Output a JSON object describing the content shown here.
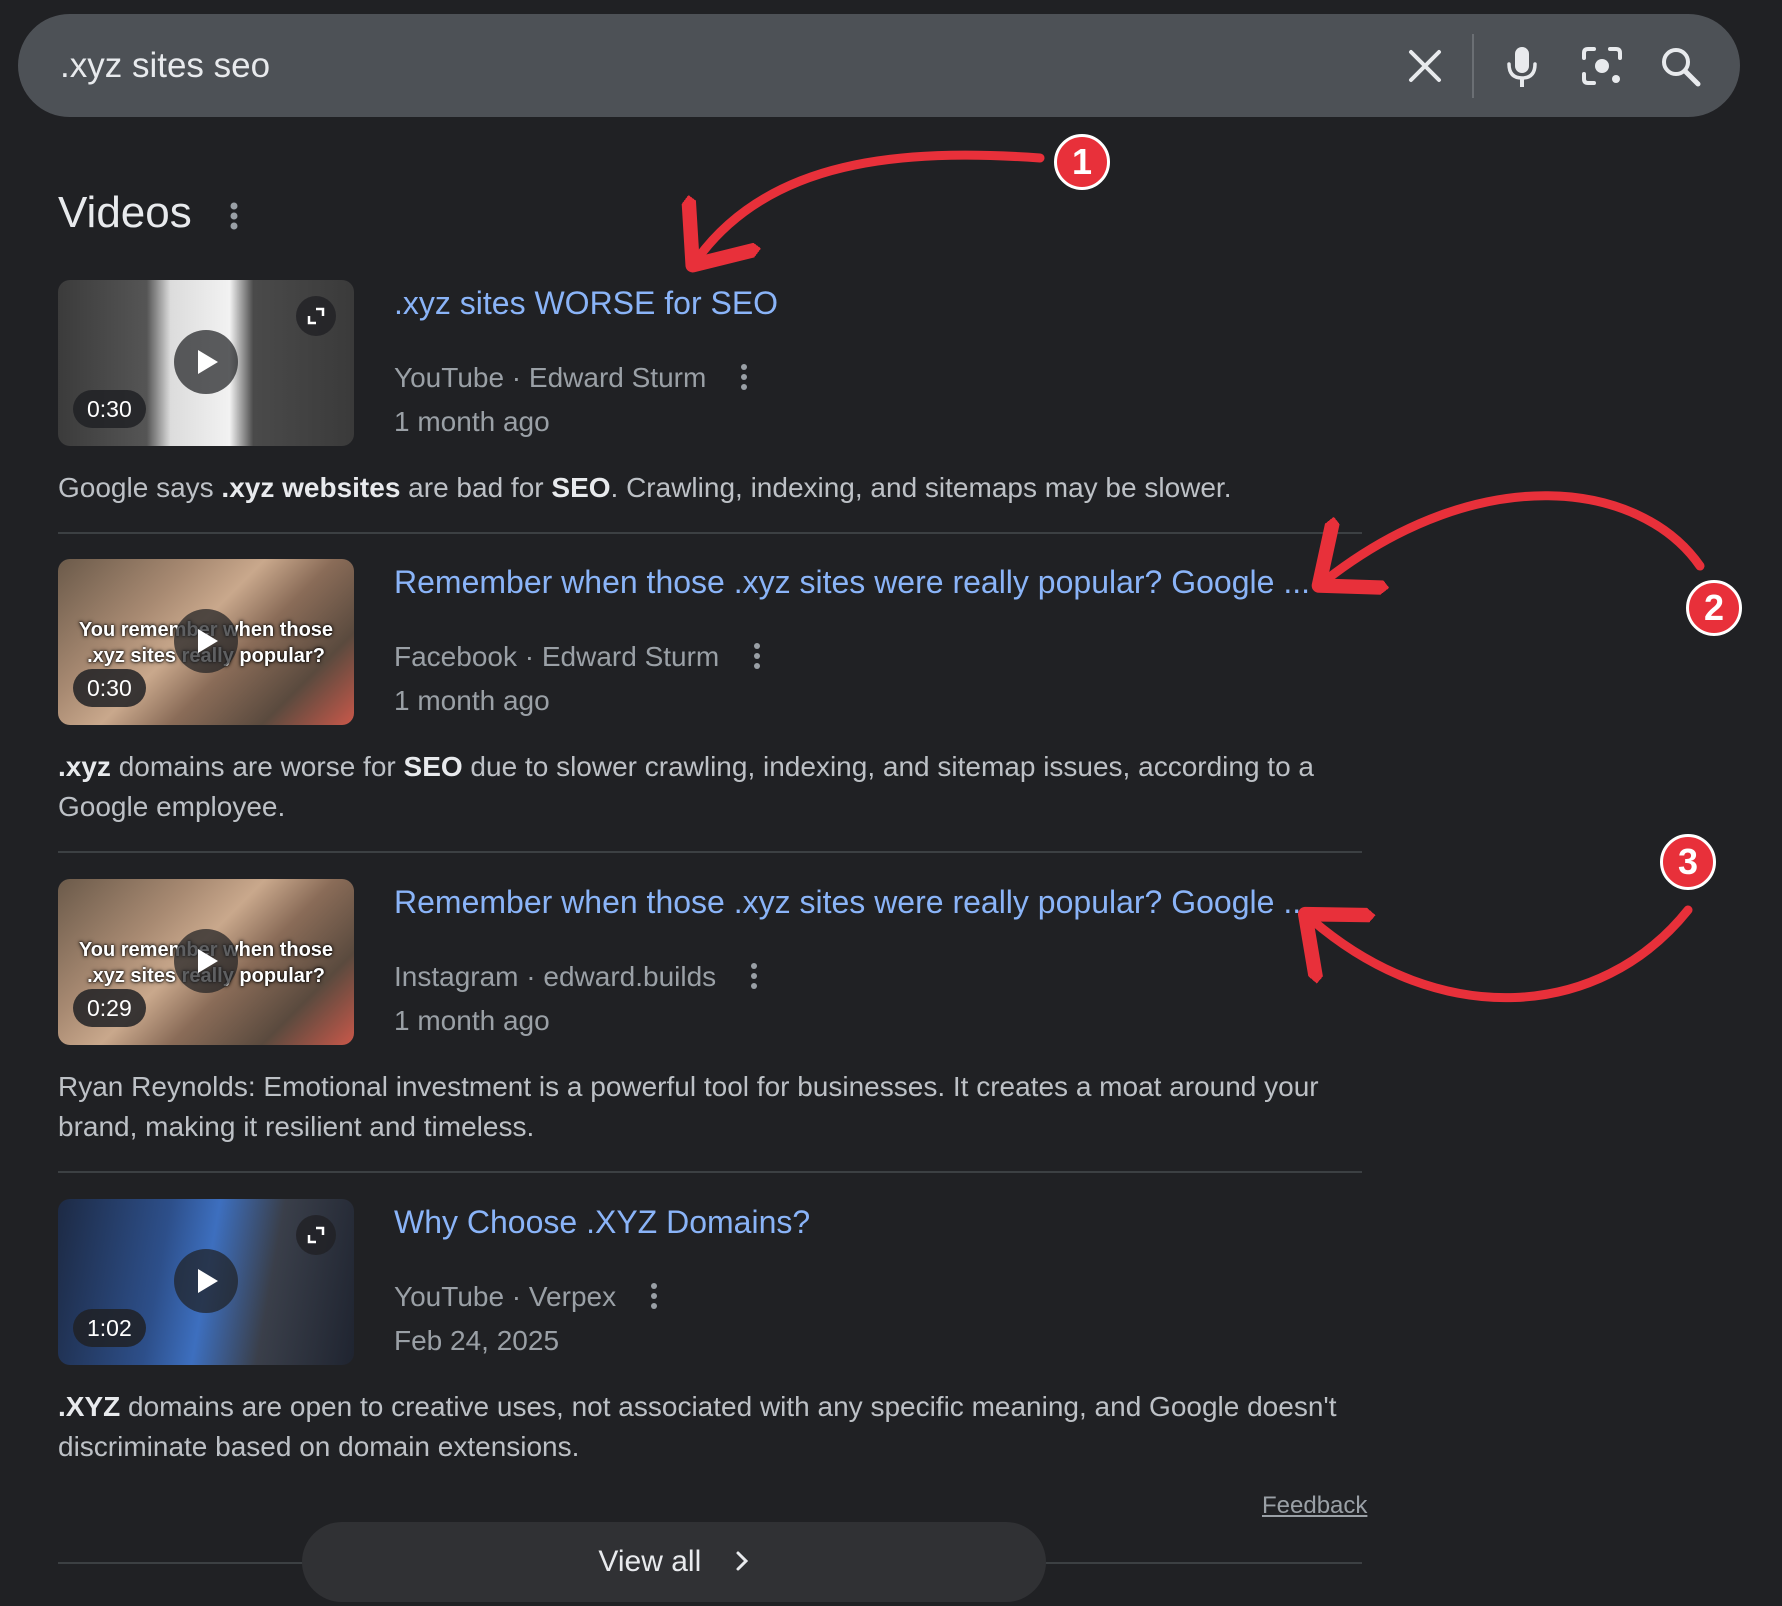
{
  "search": {
    "query": ".xyz sites seo"
  },
  "icons": {
    "clear": "close-icon",
    "mic": "microphone-icon",
    "lens": "camera-lens-icon",
    "search": "search-icon",
    "more": "more-vertical-icon",
    "play": "play-icon",
    "expand": "expand-icon",
    "chevron": "chevron-right-icon"
  },
  "colors": {
    "background": "#202124",
    "search_bar": "#4d5156",
    "link": "#8ab4f8",
    "annotation": "#e8303a"
  },
  "section": {
    "title": "Videos"
  },
  "results": [
    {
      "title": ".xyz sites WORSE for SEO",
      "source": "YouTube · Edward Sturm",
      "date": "1 month ago",
      "duration": "0:30",
      "snippet_parts": [
        {
          "text": "Google says ",
          "bold": false
        },
        {
          "text": ".xyz websites",
          "bold": true
        },
        {
          "text": " are bad for ",
          "bold": false
        },
        {
          "text": "SEO",
          "bold": true
        },
        {
          "text": ". Crawling, indexing, and sitemaps may be slower.",
          "bold": false
        }
      ]
    },
    {
      "title": "Remember when those .xyz sites were really popular? Google ...",
      "source": "Facebook · Edward Sturm",
      "date": "1 month ago",
      "duration": "0:30",
      "overlay_text": "You remember when those .xyz sites really popular?",
      "snippet_parts": [
        {
          "text": ".xyz",
          "bold": true
        },
        {
          "text": " domains are worse for ",
          "bold": false
        },
        {
          "text": "SEO",
          "bold": true
        },
        {
          "text": " due to slower crawling, indexing, and sitemap issues, according to a Google employee.",
          "bold": false
        }
      ]
    },
    {
      "title": "Remember when those .xyz sites were really popular? Google ...",
      "source": "Instagram · edward.builds",
      "date": "1 month ago",
      "duration": "0:29",
      "overlay_text": "You remember when those .xyz sites really popular?",
      "snippet_parts": [
        {
          "text": "Ryan Reynolds: Emotional investment is a powerful tool for businesses. It creates a moat around your brand, making it resilient and timeless.",
          "bold": false
        }
      ]
    },
    {
      "title": "Why Choose .XYZ Domains?",
      "source": "YouTube · Verpex",
      "date": "Feb 24, 2025",
      "duration": "1:02",
      "snippet_parts": [
        {
          "text": ".XYZ",
          "bold": true
        },
        {
          "text": " domains are open to creative uses, not associated with any specific meaning, and Google doesn't discriminate based on domain extensions.",
          "bold": false
        }
      ]
    }
  ],
  "footer": {
    "feedback": "Feedback",
    "view_all": "View all"
  },
  "annotations": [
    "1",
    "2",
    "3"
  ]
}
